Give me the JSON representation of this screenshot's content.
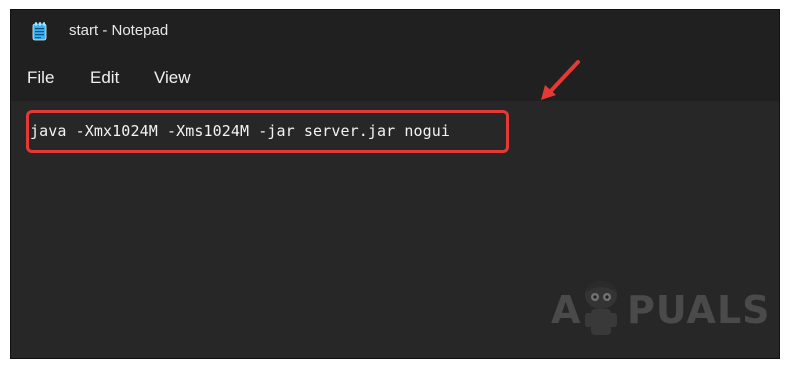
{
  "window": {
    "title": "start - Notepad",
    "icon": "notepad-icon"
  },
  "menu": {
    "file": "File",
    "edit": "Edit",
    "view": "View"
  },
  "editor": {
    "content": "java -Xmx1024M -Xms1024M -jar server.jar nogui"
  },
  "annotation": {
    "highlight_color": "#e53935",
    "arrow_color": "#e53935"
  },
  "watermark": {
    "brand": "APPUALS"
  }
}
